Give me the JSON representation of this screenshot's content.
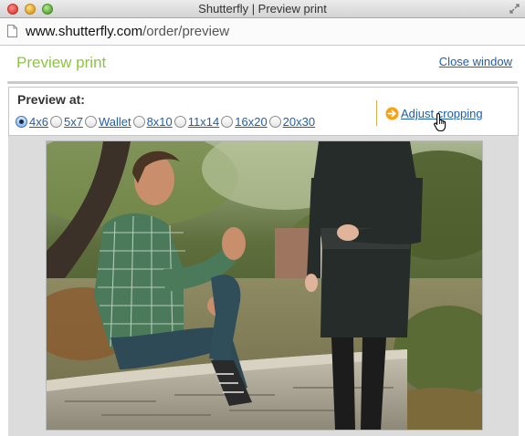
{
  "window": {
    "title": "Shutterfly | Preview print",
    "url_host": "www.shutterfly.com",
    "url_path": "/order/preview"
  },
  "header": {
    "title": "Preview print",
    "close_label": "Close window"
  },
  "options": {
    "preview_label": "Preview at:",
    "sizes": [
      {
        "label": "4x6",
        "checked": true
      },
      {
        "label": "5x7",
        "checked": false
      },
      {
        "label": "Wallet",
        "checked": false
      },
      {
        "label": "8x10",
        "checked": false
      },
      {
        "label": "11x14",
        "checked": false
      },
      {
        "label": "16x20",
        "checked": false
      },
      {
        "label": "20x30",
        "checked": false
      }
    ],
    "adjust_label": "Adjust cropping"
  },
  "icons": {
    "close": "close-window-icon",
    "minimize": "minimize-window-icon",
    "zoom": "zoom-window-icon",
    "page": "page-icon",
    "adjust": "orange-arrow-icon",
    "cursor": "hand-cursor-icon"
  },
  "colors": {
    "title_green": "#8cc63f",
    "link_blue": "#1f5ea8",
    "arrow_orange": "#f4a21a"
  }
}
